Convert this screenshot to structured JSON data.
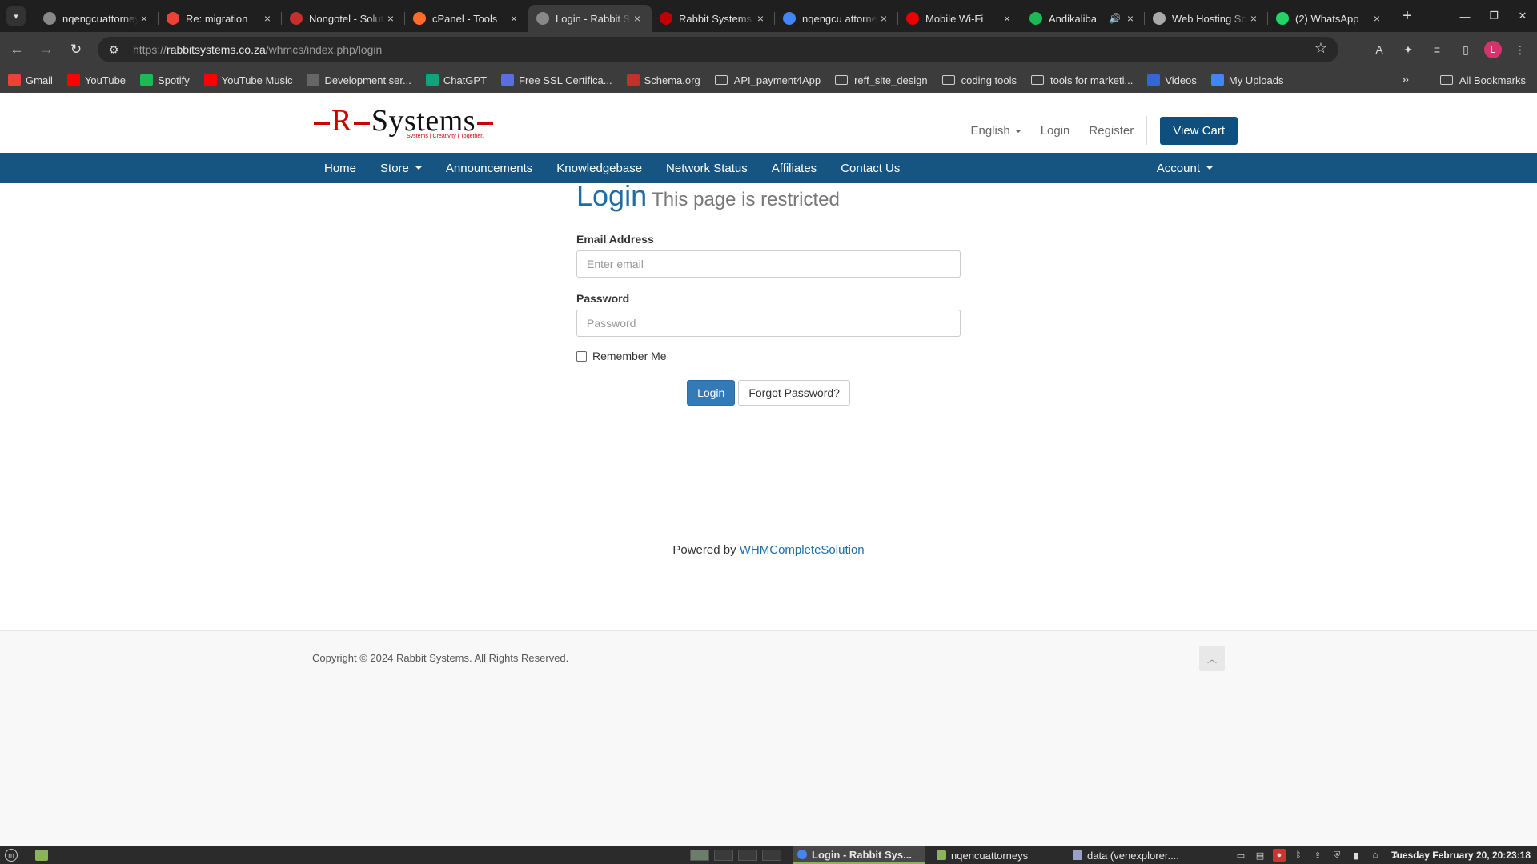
{
  "browser": {
    "tabs": [
      {
        "title": "nqengcuattorneys",
        "favicon": "globe-icon",
        "color": "#888888",
        "active": false
      },
      {
        "title": "Re: migration",
        "favicon": "gmail-icon",
        "color": "#ea4335",
        "active": false
      },
      {
        "title": "Nongotel - Solutions",
        "favicon": "nongotel-icon",
        "color": "#c4302b",
        "active": false
      },
      {
        "title": "cPanel - Tools",
        "favicon": "cpanel-icon",
        "color": "#ff6c2c",
        "active": false
      },
      {
        "title": "Login - Rabbit Systems",
        "favicon": "globe-icon",
        "color": "#888888",
        "active": true
      },
      {
        "title": "Rabbit Systems",
        "favicon": "rabbit-r-icon",
        "color": "#c00000",
        "active": false
      },
      {
        "title": "nqengcu attorneys",
        "favicon": "google-icon",
        "color": "#4285f4",
        "active": false
      },
      {
        "title": "Mobile Wi-Fi",
        "favicon": "vodafone-icon",
        "color": "#e60000",
        "active": false
      },
      {
        "title": "Andikaliba",
        "favicon": "spotify-icon",
        "color": "#1db954",
        "active": false,
        "audio": true
      },
      {
        "title": "Web Hosting South Africa",
        "favicon": "cloud-icon",
        "color": "#aaaaaa",
        "active": false
      },
      {
        "title": "(2) WhatsApp",
        "favicon": "whatsapp-icon",
        "color": "#25d366",
        "active": false
      }
    ],
    "url_scheme": "https://",
    "url_host": "rabbitsystems.co.za",
    "url_path": "/whmcs/index.php/login",
    "profile_initial": "L",
    "bookmarks": [
      {
        "label": "Gmail",
        "icon": "gmail-icon",
        "color": "#ea4335",
        "folder": false
      },
      {
        "label": "YouTube",
        "icon": "youtube-icon",
        "color": "#ff0000",
        "folder": false
      },
      {
        "label": "Spotify",
        "icon": "spotify-icon",
        "color": "#1db954",
        "folder": false
      },
      {
        "label": "YouTube Music",
        "icon": "youtube-music-icon",
        "color": "#ff0000",
        "folder": false
      },
      {
        "label": "Development ser...",
        "icon": "globe-icon",
        "color": "#666666",
        "folder": false
      },
      {
        "label": "ChatGPT",
        "icon": "chatgpt-icon",
        "color": "#10a37f",
        "folder": false
      },
      {
        "label": "Free SSL Certifica...",
        "icon": "puzzle-icon",
        "color": "#5b6ee1",
        "folder": false
      },
      {
        "label": "Schema.org",
        "icon": "schema-icon",
        "color": "#c4302b",
        "folder": false
      },
      {
        "label": "API_payment4App",
        "icon": "folder-icon",
        "color": "",
        "folder": true
      },
      {
        "label": "reff_site_design",
        "icon": "folder-icon",
        "color": "",
        "folder": true
      },
      {
        "label": "coding tools",
        "icon": "folder-icon",
        "color": "",
        "folder": true
      },
      {
        "label": "tools for marketi...",
        "icon": "folder-icon",
        "color": "",
        "folder": true
      },
      {
        "label": "Videos",
        "icon": "videos-icon",
        "color": "#3367d6",
        "folder": false
      },
      {
        "label": "My Uploads",
        "icon": "uploads-icon",
        "color": "#4285f4",
        "folder": false
      }
    ],
    "all_bookmarks_label": "All Bookmarks"
  },
  "site": {
    "logo_text": "-R-Systems-",
    "logo_tagline": "Systems | Creativity | Together.",
    "language": "English",
    "login_link": "Login",
    "register_link": "Register",
    "view_cart": "View Cart",
    "nav": {
      "home": "Home",
      "store": "Store",
      "announcements": "Announcements",
      "knowledgebase": "Knowledgebase",
      "network_status": "Network Status",
      "affiliates": "Affiliates",
      "contact": "Contact Us",
      "account": "Account"
    },
    "brand_color": "#165582"
  },
  "login": {
    "title": "Login",
    "subtitle": "This page is restricted",
    "email_label": "Email Address",
    "email_placeholder": "Enter email",
    "password_label": "Password",
    "password_placeholder": "Password",
    "remember_label": "Remember Me",
    "remember_checked": false,
    "login_button": "Login",
    "forgot_button": "Forgot Password?"
  },
  "powered": {
    "prefix": "Powered by",
    "link": "WHMCompleteSolution"
  },
  "footer": {
    "copyright": "Copyright © 2024 Rabbit Systems. All Rights Reserved."
  },
  "taskbar": {
    "tasks": [
      {
        "label": "Login - Rabbit Sys...",
        "icon": "chrome-icon",
        "active": true
      },
      {
        "label": "nqencuattorneys",
        "icon": "folder-icon",
        "active": false
      },
      {
        "label": "data (venexplorer....",
        "icon": "text-editor-icon",
        "active": false
      }
    ],
    "clock": "Tuesday February 20, 20:23:18"
  }
}
